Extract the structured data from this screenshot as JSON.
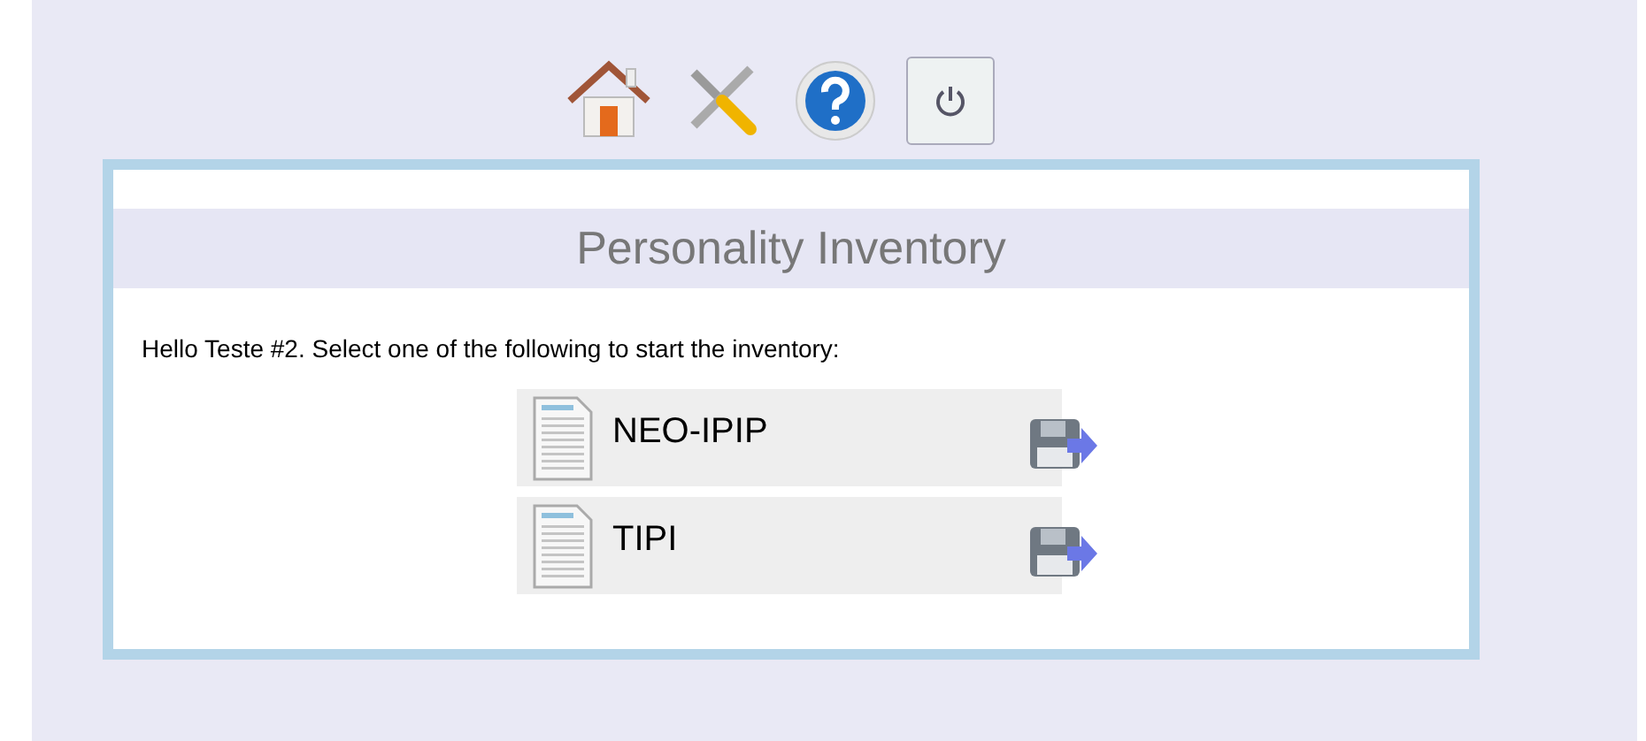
{
  "title": "Personality Inventory",
  "greeting": "Hello Teste #2. Select one of the following to start the inventory:",
  "inventories": [
    {
      "name": "NEO-IPIP"
    },
    {
      "name": "TIPI"
    }
  ]
}
